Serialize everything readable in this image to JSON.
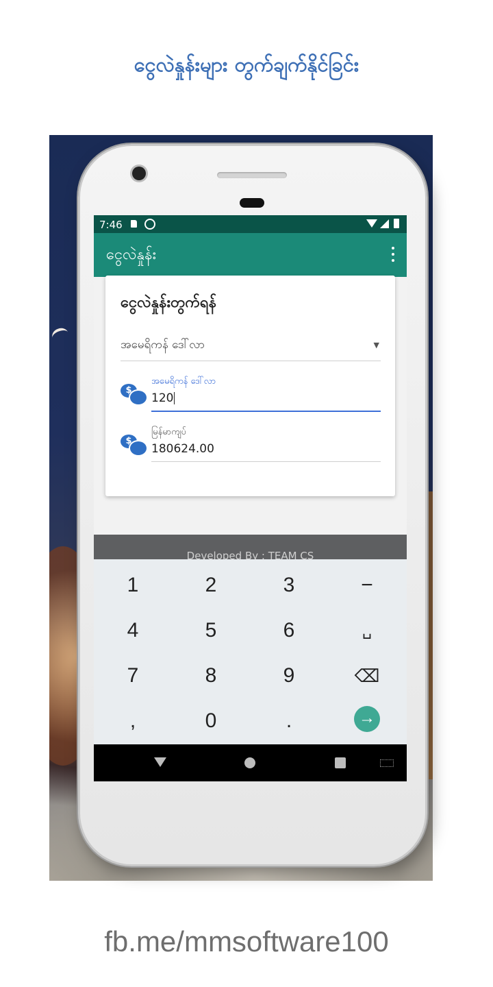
{
  "headline": "ငွေလဲနှုန်းများ တွက်ချက်နိုင်ခြင်း",
  "footer_link": "fb.me/mmsoftware100",
  "status_bar": {
    "time": "7:46"
  },
  "app_bar": {
    "title": "ငွေလဲနှုန်း"
  },
  "calculator_card": {
    "heading": "ငွေလဲနှုန်းတွက်ရန်",
    "currency_select": {
      "selected": "အမေရိကန် ဒေါ်လာ"
    },
    "input_field": {
      "label": "အမေရိကန် ဒေါ်လာ",
      "value": "120"
    },
    "result_field": {
      "label": "မြန်မာကျပ်",
      "value": "180624.00"
    }
  },
  "developer_bar": {
    "text": "Developed By : TEAM CS"
  },
  "keyboard": {
    "keys": [
      "1",
      "2",
      "3",
      "−",
      "4",
      "5",
      "6",
      "␣",
      "7",
      "8",
      "9",
      "⌫",
      ",",
      "0",
      "."
    ],
    "action_key": "→"
  },
  "colors": {
    "status_bar": "#0a5448",
    "app_bar": "#1b8a78",
    "accent": "#3d6fd8",
    "headline": "#3d6fb5",
    "action_key": "#3fa994"
  },
  "icons": {
    "money": "money-exchange-icon",
    "dropdown": "dropdown-arrow-icon"
  }
}
